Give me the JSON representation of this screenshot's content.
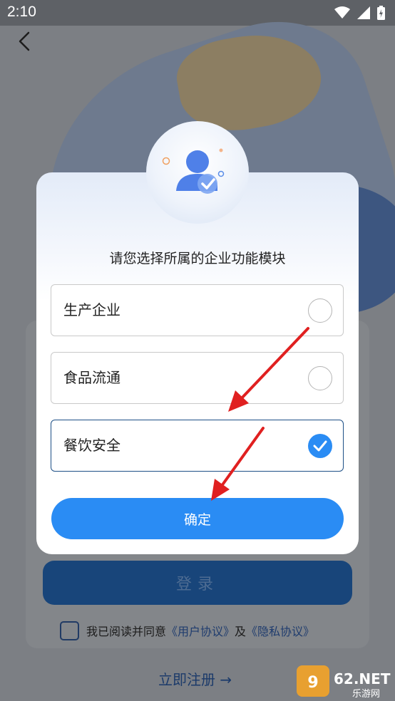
{
  "status_bar": {
    "time": "2:10"
  },
  "dialog": {
    "title": "请您选择所属的企业功能模块",
    "options": [
      {
        "label": "生产企业",
        "selected": false
      },
      {
        "label": "食品流通",
        "selected": false
      },
      {
        "label": "餐饮安全",
        "selected": true
      }
    ],
    "confirm_label": "确定"
  },
  "login": {
    "button_label": "登录",
    "agree_text": "我已阅读并同意",
    "user_agreement": "《用户协议》",
    "and_text": "及",
    "privacy_policy": "《隐私协议》",
    "register_label": "立即注册 →"
  },
  "watermark": {
    "text": "962.NET",
    "subtext": "乐游网"
  },
  "colors": {
    "accent": "#2a8cf4",
    "selected_border": "#1d4f86",
    "annotation_arrow": "#e02020"
  }
}
